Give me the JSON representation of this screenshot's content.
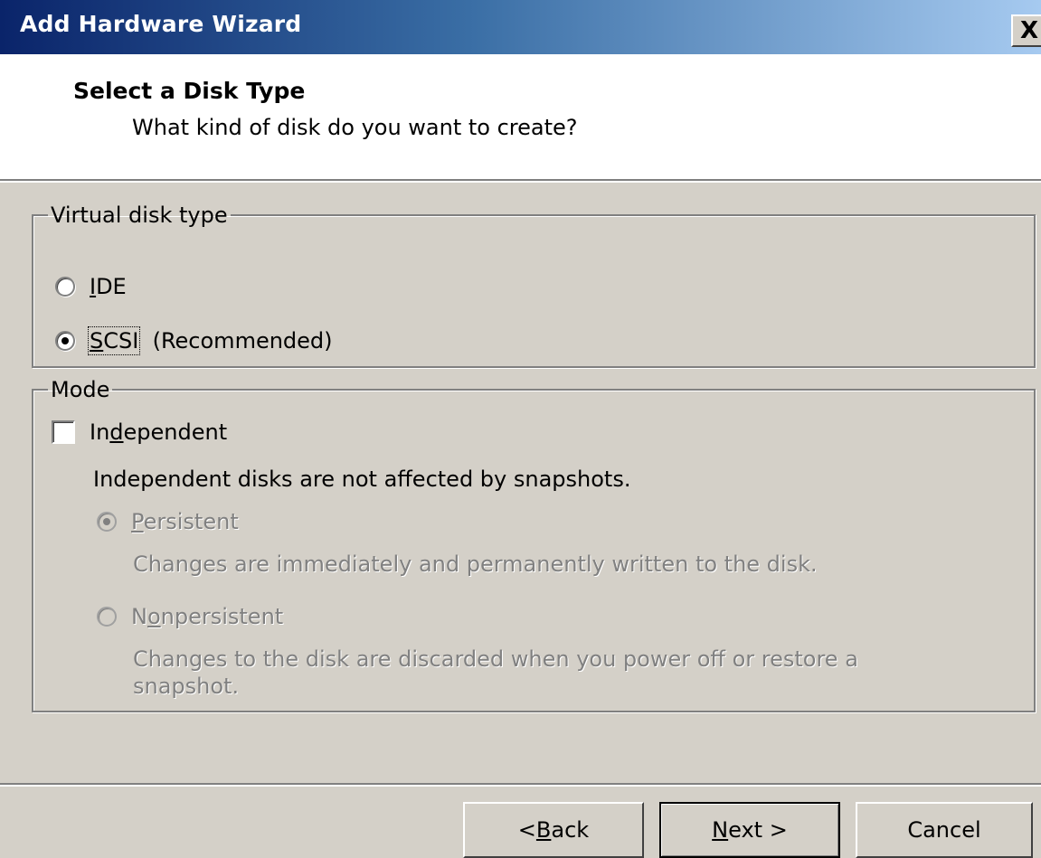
{
  "window": {
    "title": "Add Hardware Wizard",
    "close_glyph": "X"
  },
  "header": {
    "title": "Select a Disk Type",
    "subtitle": "What kind of disk do you want to create?"
  },
  "disk_type": {
    "legend": "Virtual disk type",
    "options": [
      {
        "mnemonic": "I",
        "rest": "DE",
        "suffix": "",
        "selected": false
      },
      {
        "mnemonic": "S",
        "rest": "CSI",
        "suffix": "(Recommended)",
        "selected": true
      }
    ]
  },
  "mode": {
    "legend": "Mode",
    "independent": {
      "pre": "In",
      "mnemonic": "d",
      "post": "ependent",
      "checked": false
    },
    "independent_note": "Independent disks are not affected by snapshots.",
    "persistent": {
      "pre": "",
      "mnemonic": "P",
      "post": "ersistent",
      "selected": true,
      "enabled": false,
      "description": "Changes are immediately and permanently written to the disk."
    },
    "nonpersistent": {
      "pre": "N",
      "mnemonic": "o",
      "post": "npersistent",
      "selected": false,
      "enabled": false,
      "description_line1": "Changes to the disk are discarded when you power off or restore a",
      "description_line2": "snapshot."
    }
  },
  "buttons": {
    "back": {
      "pre": "< ",
      "mnemonic": "B",
      "post": "ack"
    },
    "next": {
      "pre": "",
      "mnemonic": "N",
      "post": "ext >"
    },
    "cancel": "Cancel"
  },
  "colors": {
    "dialog_bg": "#d4d0c8",
    "title_gradient_start": "#0a246a",
    "title_gradient_end": "#a6caf0",
    "disabled_text": "#808080"
  }
}
